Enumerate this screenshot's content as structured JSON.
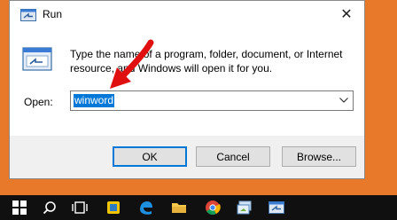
{
  "window": {
    "title": "Run",
    "close_glyph": "✕"
  },
  "dialog": {
    "description": "Type the name of a program, folder, document, or Internet resource, and Windows will open it for you.",
    "open_label": "Open:",
    "open_value": "winword"
  },
  "buttons": {
    "ok": "OK",
    "cancel": "Cancel",
    "browse": "Browse..."
  },
  "taskbar": {
    "items": [
      "windows-start",
      "search",
      "task-view",
      "app-yellow",
      "edge",
      "file-explorer",
      "chrome",
      "app-window",
      "run"
    ]
  },
  "colors": {
    "desktop": "#E8792B",
    "accent": "#0078D7",
    "taskbar": "#101010",
    "annotation_arrow": "#E01010"
  }
}
